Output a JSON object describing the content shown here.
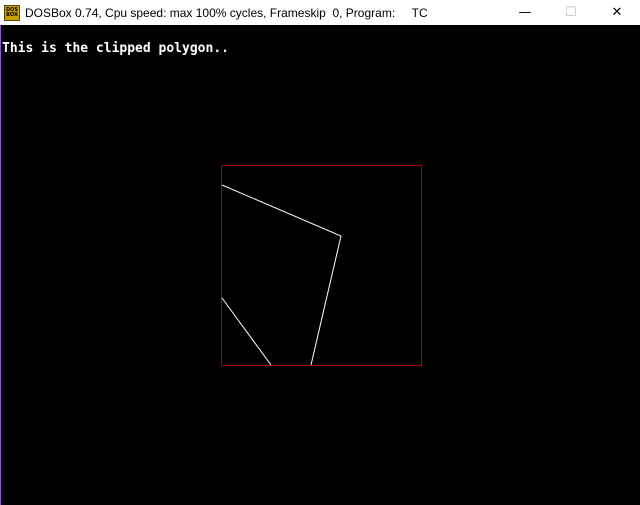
{
  "window": {
    "title": "DOSBox 0.74, Cpu speed: max 100% cycles, Frameskip  0, Program:     TC",
    "icon_text_top": "DOS",
    "icon_text_bottom": "BOX",
    "controls": {
      "minimize_glyph": "—",
      "maximize_glyph": "☐",
      "close_glyph": "✕"
    }
  },
  "screen": {
    "message": "This is the clipped polygon..",
    "colors": {
      "background": "#000000",
      "clip_window": "#aa0000",
      "polygon": "#ffffff",
      "text": "#ffffff"
    }
  }
}
